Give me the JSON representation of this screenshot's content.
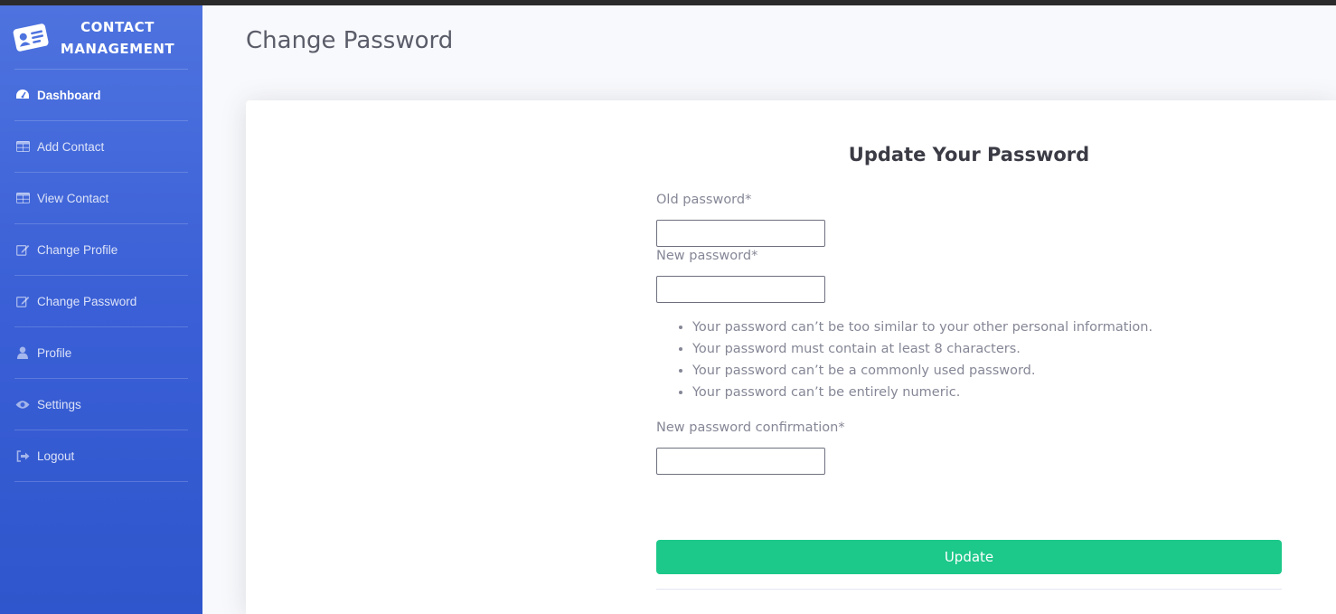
{
  "brand": {
    "line1": "CONTACT",
    "line2": "MANAGEMENT",
    "icon": "contact-card-icon"
  },
  "sidebar": {
    "items": [
      {
        "label": "Dashboard",
        "icon": "tachometer-icon",
        "active": true
      },
      {
        "label": "Add Contact",
        "icon": "table-icon"
      },
      {
        "label": "View Contact",
        "icon": "table-icon"
      },
      {
        "label": "Change Profile",
        "icon": "edit-icon"
      },
      {
        "label": "Change Password",
        "icon": "edit-icon"
      },
      {
        "label": "Profile",
        "icon": "user-icon"
      },
      {
        "label": "Settings",
        "icon": "eye-icon"
      },
      {
        "label": "Logout",
        "icon": "sign-out-icon"
      }
    ]
  },
  "page": {
    "title": "Change Password"
  },
  "form": {
    "heading": "Update Your Password",
    "old_password_label": "Old password*",
    "old_password_value": "",
    "new_password_label": "New password*",
    "new_password_value": "",
    "help": [
      "Your password can’t be too similar to your other personal information.",
      "Your password must contain at least 8 characters.",
      "Your password can’t be a commonly used password.",
      "Your password can’t be entirely numeric."
    ],
    "confirm_label": "New password confirmation*",
    "confirm_value": "",
    "submit_label": "Update"
  },
  "colors": {
    "sidebar_top": "#4e73df",
    "sidebar_bottom": "#2f56cc",
    "button": "#1cc88a",
    "title_text": "#5a5c69",
    "label_text": "#858796"
  }
}
